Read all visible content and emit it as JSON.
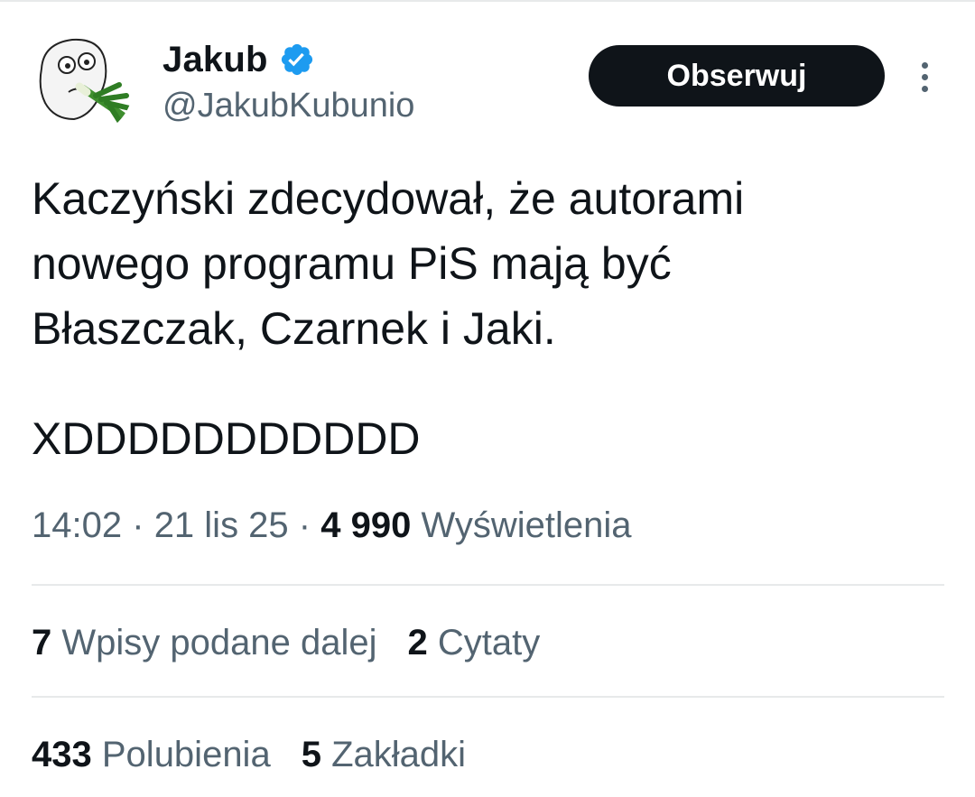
{
  "author": {
    "display_name": "Jakub",
    "handle": "@JakubKubunio",
    "verified": true,
    "verified_color": "#1d9bf0"
  },
  "actions": {
    "follow_label": "Obserwuj",
    "more_icon": "more-vertical-icon"
  },
  "tweet": {
    "lines": [
      "Kaczyński zdecydował, że autorami",
      "nowego programu PiS mają być",
      "Błaszczak, Czarnek i Jaki.",
      "XDDDDDDDDDDD"
    ]
  },
  "meta": {
    "time": "14:02",
    "separator": "·",
    "date": "21 lis 25",
    "views_count": "4 990",
    "views_label": "Wyświetlenia"
  },
  "stats": {
    "retweets_count": "7",
    "retweets_label": "Wpisy podane dalej",
    "quotes_count": "2",
    "quotes_label": "Cytaty",
    "likes_count": "433",
    "likes_label": "Polubienia",
    "bookmarks_count": "5",
    "bookmarks_label": "Zakładki"
  },
  "colors": {
    "text_primary": "#0f1419",
    "text_secondary": "#536471",
    "divider": "#e7e9ea",
    "button_bg": "#0f1419"
  }
}
